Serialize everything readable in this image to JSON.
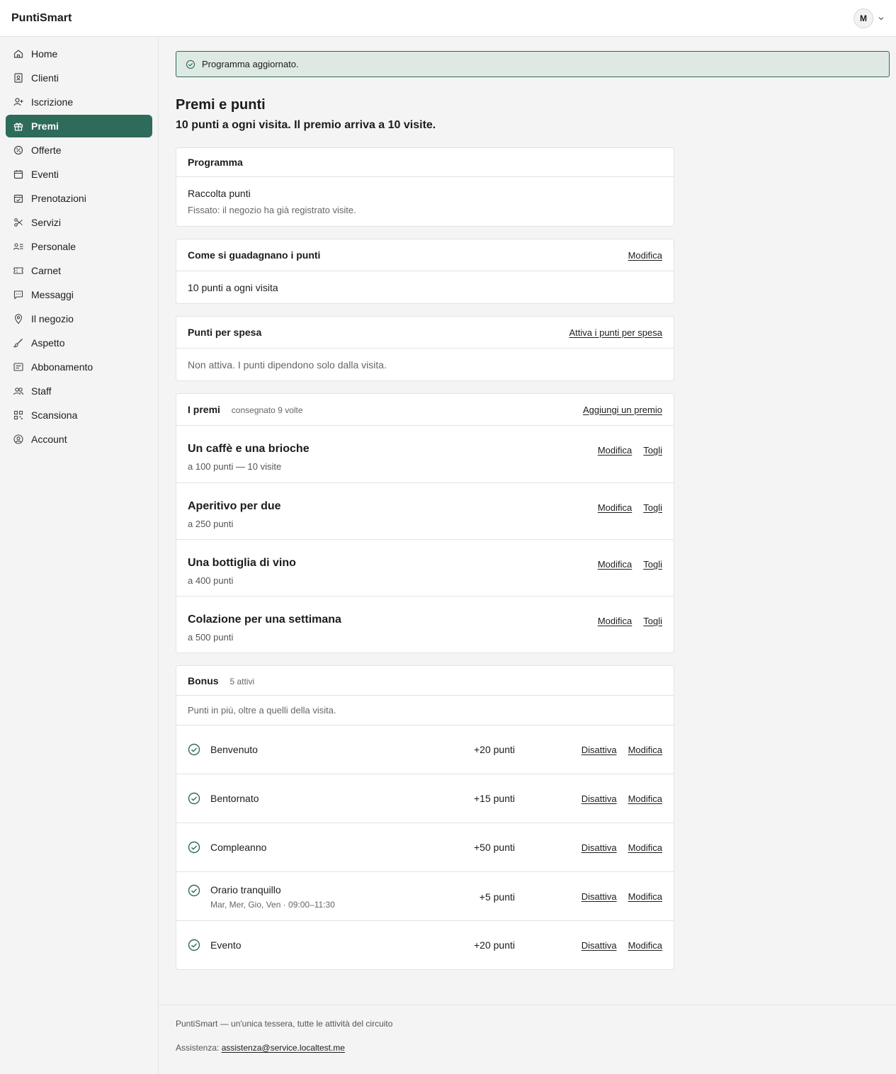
{
  "app": {
    "brand": "PuntiSmart"
  },
  "user": {
    "initial": "M"
  },
  "sidebar": {
    "items": [
      {
        "label": "Home",
        "icon": "home-icon"
      },
      {
        "label": "Clienti",
        "icon": "contacts-icon"
      },
      {
        "label": "Iscrizione",
        "icon": "user-add-icon"
      },
      {
        "label": "Premi",
        "icon": "gift-icon",
        "active": true
      },
      {
        "label": "Offerte",
        "icon": "offer-icon"
      },
      {
        "label": "Eventi",
        "icon": "calendar-icon"
      },
      {
        "label": "Prenotazioni",
        "icon": "calendar-check-icon"
      },
      {
        "label": "Servizi",
        "icon": "scissors-icon"
      },
      {
        "label": "Personale",
        "icon": "staff-list-icon"
      },
      {
        "label": "Carnet",
        "icon": "ticket-icon"
      },
      {
        "label": "Messaggi",
        "icon": "message-icon"
      },
      {
        "label": "Il negozio",
        "icon": "location-pin-icon"
      },
      {
        "label": "Aspetto",
        "icon": "brush-icon"
      },
      {
        "label": "Abbonamento",
        "icon": "subscription-icon"
      },
      {
        "label": "Staff",
        "icon": "users-icon"
      },
      {
        "label": "Scansiona",
        "icon": "qr-icon"
      },
      {
        "label": "Account",
        "icon": "account-icon"
      }
    ]
  },
  "flash": {
    "message": "Programma aggiornato."
  },
  "page": {
    "title": "Premi e punti",
    "subtitle": "10 punti a ogni visita. Il premio arriva a 10 visite."
  },
  "program": {
    "title": "Programma",
    "name": "Raccolta punti",
    "note": "Fissato: il negozio ha già registrato visite."
  },
  "earning": {
    "title": "Come si guadagnano i punti",
    "action": "Modifica",
    "value": "10 punti a ogni visita"
  },
  "spend": {
    "title": "Punti per spesa",
    "action": "Attiva i punti per spesa",
    "value": "Non attiva. I punti dipendono solo dalla visita."
  },
  "rewards": {
    "title": "I premi",
    "meta": "consegnato 9 volte",
    "action": "Aggiungi un premio",
    "edit_label": "Modifica",
    "remove_label": "Togli",
    "items": [
      {
        "name": "Un caffè e una brioche",
        "points": "a 100 punti — 10 visite"
      },
      {
        "name": "Aperitivo per due",
        "points": "a 250 punti"
      },
      {
        "name": "Una bottiglia di vino",
        "points": "a 400 punti"
      },
      {
        "name": "Colazione per una settimana",
        "points": "a 500 punti"
      }
    ]
  },
  "bonus": {
    "title": "Bonus",
    "meta": "5 attivi",
    "intro": "Punti in più, oltre a quelli della visita.",
    "disable_label": "Disattiva",
    "edit_label": "Modifica",
    "items": [
      {
        "name": "Benvenuto",
        "detail": "",
        "points": "+20 punti"
      },
      {
        "name": "Bentornato",
        "detail": "",
        "points": "+15 punti"
      },
      {
        "name": "Compleanno",
        "detail": "",
        "points": "+50 punti"
      },
      {
        "name": "Orario tranquillo",
        "detail": "Mar, Mer, Gio, Ven · 09:00–11:30",
        "points": "+5 punti"
      },
      {
        "name": "Evento",
        "detail": "",
        "points": "+20 punti"
      }
    ]
  },
  "footer": {
    "tagline": "PuntiSmart — un'unica tessera, tutte le attività del circuito",
    "support_label": "Assistenza:",
    "support_email": "assistenza@service.localtest.me"
  },
  "colors": {
    "accent": "#2e6b5a",
    "flash_bg": "#dfe9e4"
  }
}
